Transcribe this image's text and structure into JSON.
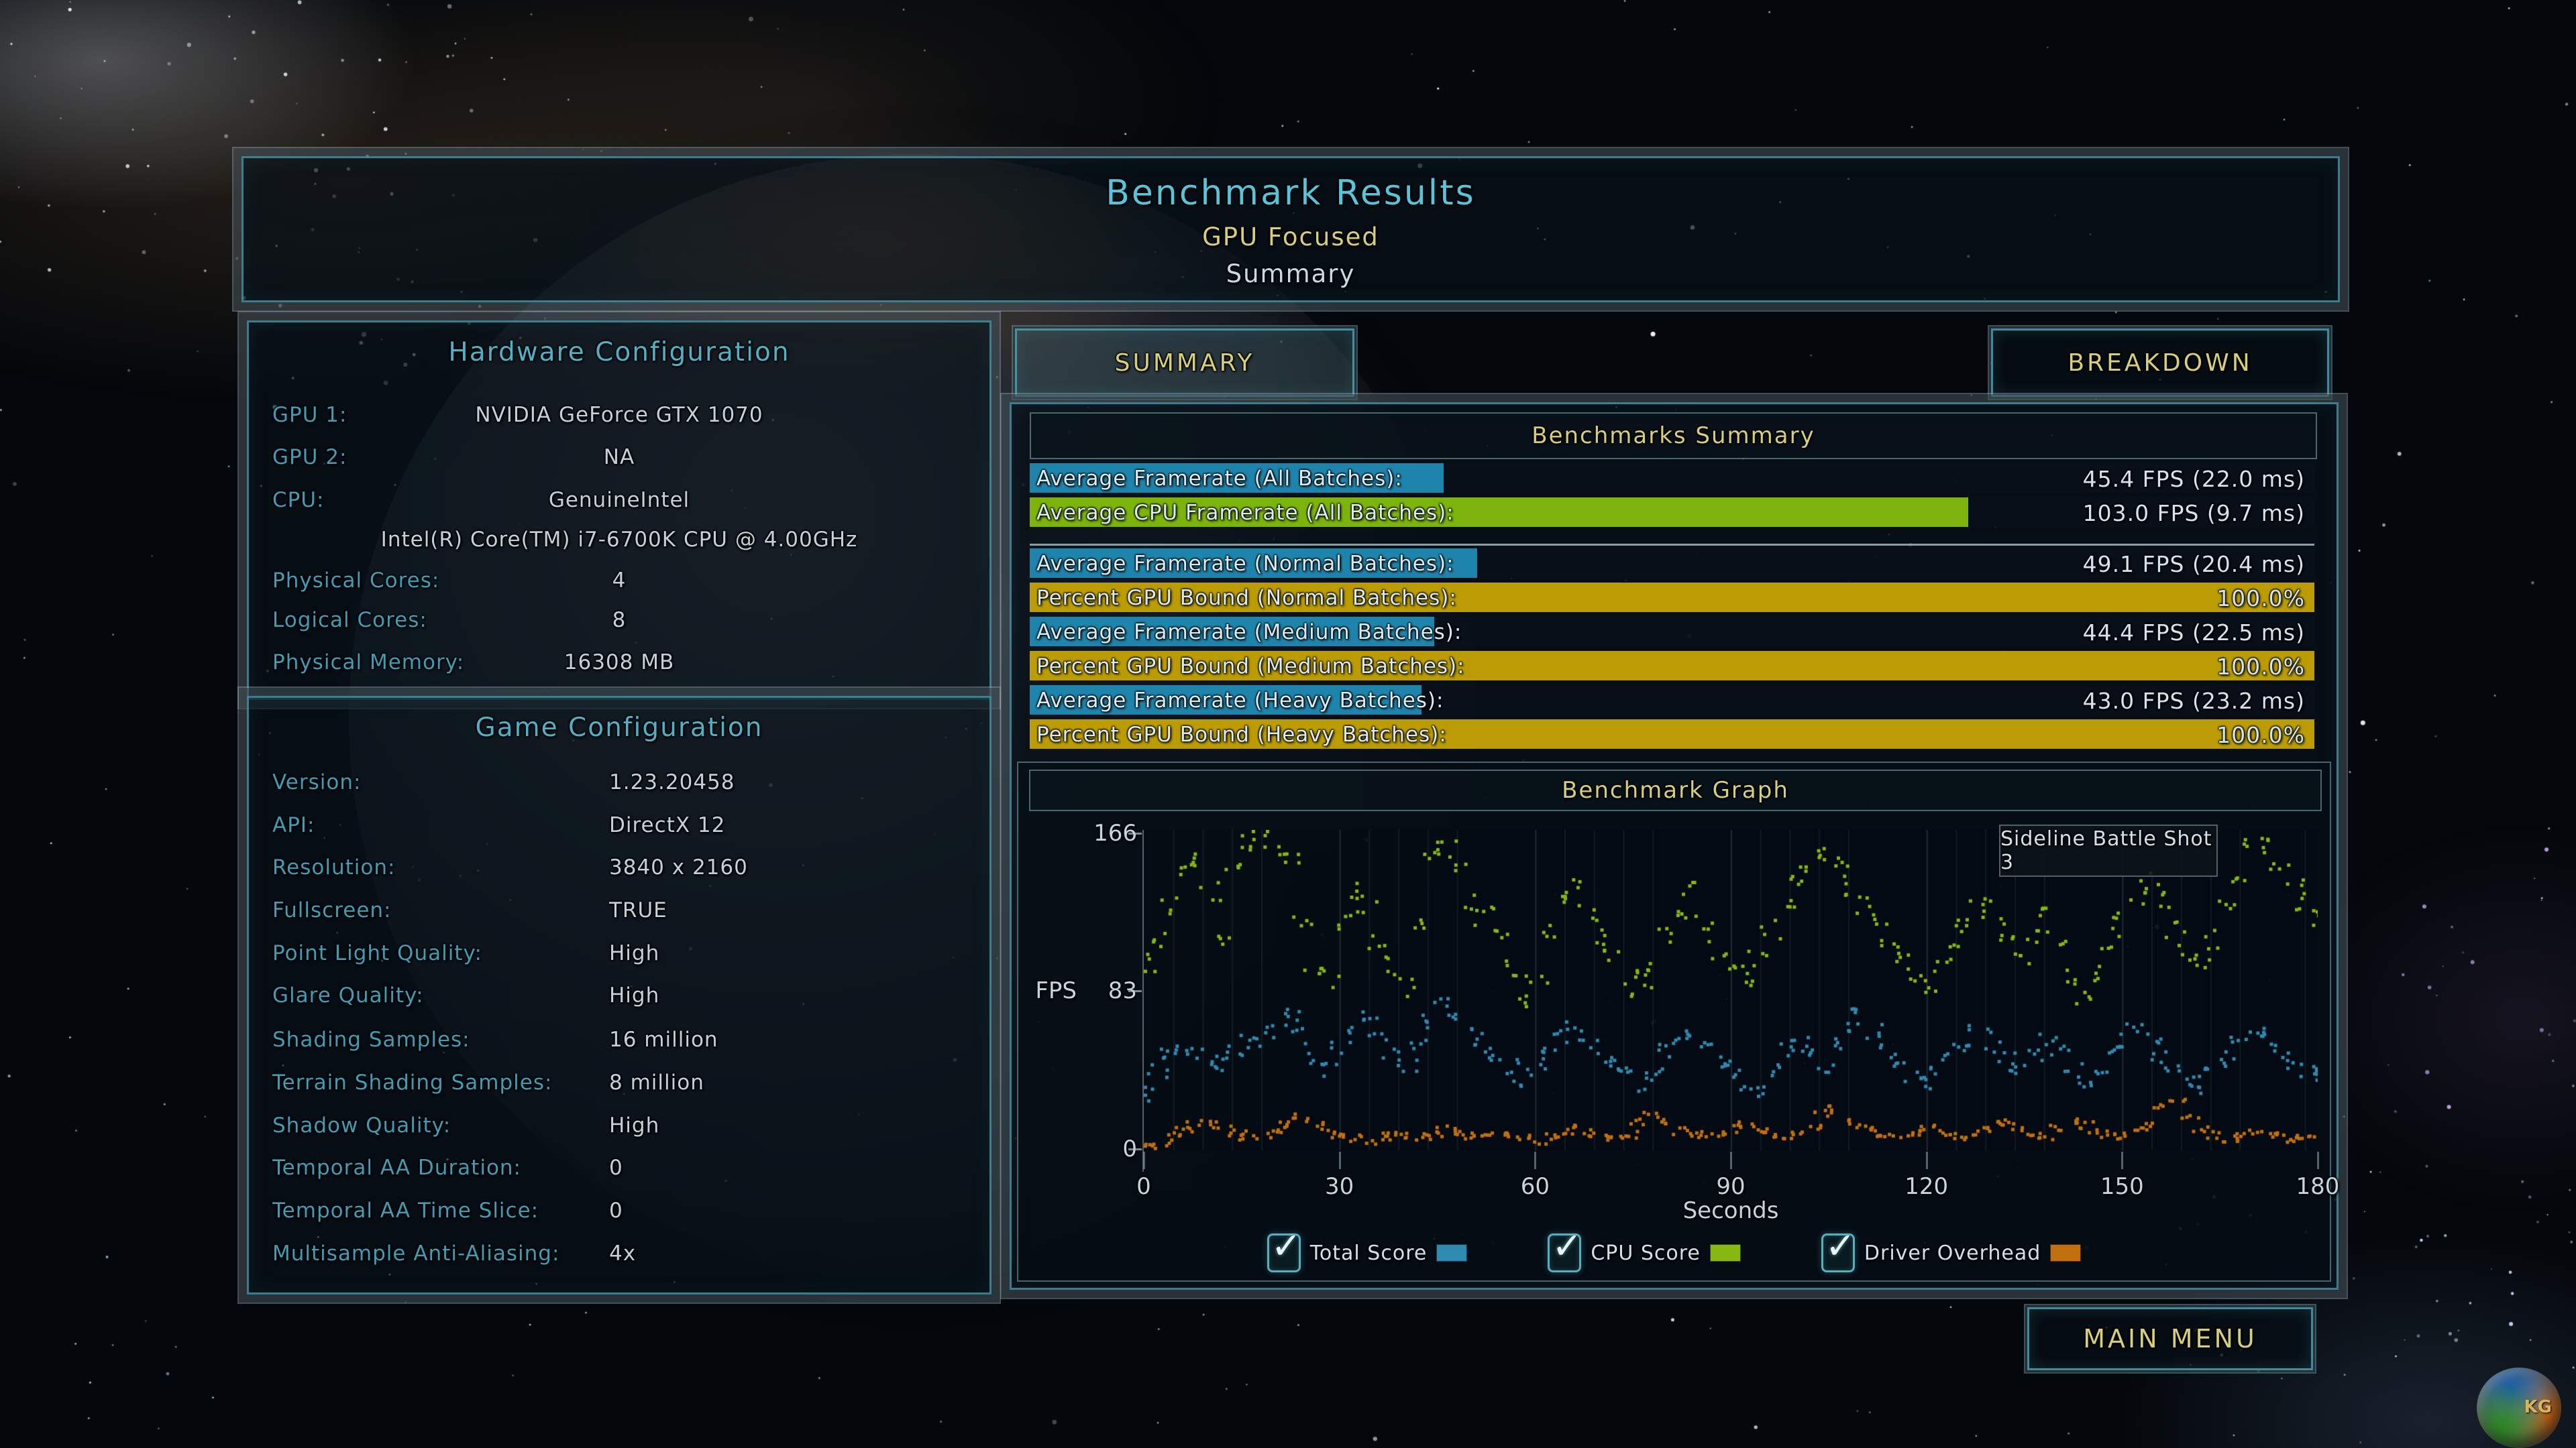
{
  "banner": {
    "title": "Benchmark Results",
    "subtitle": "GPU Focused",
    "mode": "Summary"
  },
  "hardware": {
    "title": "Hardware Configuration",
    "rows": [
      {
        "label": "GPU 1:",
        "value": "NVIDIA GeForce GTX 1070"
      },
      {
        "label": "GPU 2:",
        "value": "NA"
      },
      {
        "label": "CPU:",
        "value": "GenuineIntel"
      },
      {
        "label": "",
        "value": "Intel(R) Core(TM) i7-6700K CPU @ 4.00GHz",
        "full": true
      },
      {
        "label": "Physical Cores:",
        "value": "4"
      },
      {
        "label": "Logical Cores:",
        "value": "8"
      },
      {
        "label": "Physical Memory:",
        "value": "16308 MB"
      }
    ]
  },
  "game": {
    "title": "Game Configuration",
    "rows": [
      {
        "label": "Version:",
        "value": "1.23.20458"
      },
      {
        "label": "API:",
        "value": "DirectX 12"
      },
      {
        "label": "Resolution:",
        "value": "3840 x 2160"
      },
      {
        "label": "Fullscreen:",
        "value": "TRUE"
      },
      {
        "label": "Point Light Quality:",
        "value": "High"
      },
      {
        "label": "Glare Quality:",
        "value": "High"
      },
      {
        "label": "Shading Samples:",
        "value": "16 million"
      },
      {
        "label": "Terrain Shading Samples:",
        "value": "8 million"
      },
      {
        "label": "Shadow Quality:",
        "value": "High"
      },
      {
        "label": "Temporal AA Duration:",
        "value": "0"
      },
      {
        "label": "Temporal AA Time Slice:",
        "value": "0"
      },
      {
        "label": "Multisample Anti-Aliasing:",
        "value": "4x"
      }
    ]
  },
  "tabs": {
    "summary": "SUMMARY",
    "breakdown": "BREAKDOWN"
  },
  "summary_table": {
    "title": "Benchmarks Summary",
    "bar_scale_max_fps": 141,
    "rows": [
      {
        "label": "Average Framerate (All Batches):",
        "value_text": "45.4 FPS (22.0 ms)",
        "fps": 45.4,
        "color": "bar_blue"
      },
      {
        "label": "Average CPU Framerate (All Batches):",
        "value_text": "103.0 FPS (9.7 ms)",
        "fps": 103.0,
        "color": "bar_green"
      },
      {
        "label": "Average Framerate (Normal Batches):",
        "value_text": "49.1 FPS (20.4 ms)",
        "fps": 49.1,
        "color": "bar_blue",
        "sep_before": true
      },
      {
        "label": "Percent GPU Bound (Normal Batches):",
        "value_text": "100.0%",
        "percent": 100.0,
        "color": "bar_gold"
      },
      {
        "label": "Average Framerate (Medium Batches):",
        "value_text": "44.4 FPS (22.5 ms)",
        "fps": 44.4,
        "color": "bar_blue"
      },
      {
        "label": "Percent GPU Bound (Medium Batches):",
        "value_text": "100.0%",
        "percent": 100.0,
        "color": "bar_gold"
      },
      {
        "label": "Average Framerate (Heavy Batches):",
        "value_text": "43.0 FPS (23.2 ms)",
        "fps": 43.0,
        "color": "bar_blue"
      },
      {
        "label": "Percent GPU Bound (Heavy Batches):",
        "value_text": "100.0%",
        "percent": 100.0,
        "color": "bar_gold"
      }
    ]
  },
  "graph": {
    "title": "Benchmark Graph",
    "tooltip": "Sideline Battle Shot 3",
    "ylabel": "FPS",
    "xlabel": "Seconds",
    "yticks": {
      "top": "166",
      "mid": "83",
      "bottom": "0"
    },
    "legend": [
      {
        "label": "Total Score",
        "color": "#2e8ab0",
        "checked": true
      },
      {
        "label": "CPU Score",
        "color": "#86b811",
        "checked": true
      },
      {
        "label": "Driver Overhead",
        "color": "#c2700f",
        "checked": true
      }
    ]
  },
  "chart_data": {
    "type": "scatter",
    "title": "Benchmark Graph",
    "xlabel": "Seconds",
    "ylabel": "FPS",
    "xlim": [
      0,
      180
    ],
    "ylim": [
      0,
      166
    ],
    "xticks": [
      0,
      30,
      60,
      90,
      120,
      150,
      180
    ],
    "yticks": [
      0,
      83,
      166
    ],
    "x_step_seconds": 2,
    "annotation": "Sideline Battle Shot 3",
    "gridline_times": [
      4.5,
      9,
      13.5,
      18,
      30,
      34.5,
      39,
      43.5,
      48,
      60,
      64.5,
      69,
      73.5,
      78,
      90,
      94.5,
      99,
      103.5,
      108,
      120,
      124.5,
      129,
      133.5,
      138,
      150,
      154.5,
      159,
      163.5,
      168,
      178
    ],
    "series": [
      {
        "name": "Total Score",
        "color": "#2e8ab0",
        "spread": 8,
        "values": [
          30,
          42,
          50,
          55,
          52,
          48,
          45,
          52,
          58,
          62,
          68,
          72,
          60,
          48,
          42,
          55,
          65,
          72,
          60,
          50,
          44,
          55,
          68,
          78,
          70,
          60,
          55,
          50,
          44,
          38,
          46,
          55,
          60,
          64,
          58,
          50,
          45,
          40,
          35,
          42,
          52,
          58,
          62,
          55,
          48,
          42,
          36,
          30,
          42,
          52,
          58,
          50,
          44,
          55,
          65,
          72,
          62,
          52,
          46,
          40,
          36,
          44,
          52,
          58,
          62,
          55,
          48,
          42,
          50,
          58,
          52,
          42,
          35,
          44,
          52,
          58,
          64,
          58,
          50,
          44,
          38,
          33,
          42,
          50,
          56,
          62,
          58,
          52,
          46,
          42,
          40
        ]
      },
      {
        "name": "CPU Score",
        "color": "#86b811",
        "spread": 10,
        "values": [
          98,
          110,
          128,
          145,
          150,
          135,
          112,
          150,
          160,
          163,
          158,
          150,
          120,
          95,
          88,
          118,
          135,
          128,
          108,
          96,
          85,
          118,
          152,
          160,
          148,
          130,
          122,
          110,
          96,
          80,
          92,
          115,
          130,
          138,
          125,
          112,
          100,
          90,
          82,
          95,
          112,
          125,
          135,
          120,
          105,
          95,
          88,
          100,
          115,
          130,
          142,
          150,
          155,
          148,
          138,
          128,
          118,
          108,
          98,
          90,
          84,
          96,
          110,
          122,
          132,
          120,
          108,
          98,
          110,
          122,
          112,
          90,
          78,
          92,
          108,
          120,
          132,
          140,
          130,
          116,
          104,
          96,
          110,
          128,
          145,
          158,
          162,
          150,
          138,
          128,
          120
        ]
      },
      {
        "name": "Driver Overhead",
        "color": "#c2700f",
        "spread": 4,
        "values": [
          3,
          5,
          8,
          11,
          14,
          16,
          13,
          10,
          8,
          9,
          12,
          15,
          18,
          15,
          11,
          8,
          7,
          6,
          8,
          10,
          9,
          8,
          10,
          12,
          10,
          8,
          7,
          8,
          9,
          7,
          6,
          8,
          10,
          12,
          10,
          8,
          7,
          9,
          16,
          19,
          15,
          11,
          9,
          8,
          10,
          12,
          14,
          11,
          9,
          8,
          10,
          13,
          20,
          22,
          16,
          12,
          10,
          9,
          8,
          10,
          12,
          10,
          8,
          9,
          11,
          14,
          16,
          13,
          10,
          8,
          12,
          16,
          14,
          10,
          8,
          9,
          11,
          13,
          24,
          28,
          18,
          12,
          9,
          7,
          8,
          10,
          9,
          8,
          7,
          8,
          9
        ]
      }
    ]
  },
  "main_menu_label": "MAIN MENU",
  "logo_text": "KG",
  "colors": {
    "bar_blue": "#1f84ac",
    "bar_green": "#7cb40d",
    "bar_gold": "#bb9c05",
    "accent_teal": "#4fa3b4",
    "yellow": "#d8ce79",
    "cyan_title": "#58c4da"
  }
}
